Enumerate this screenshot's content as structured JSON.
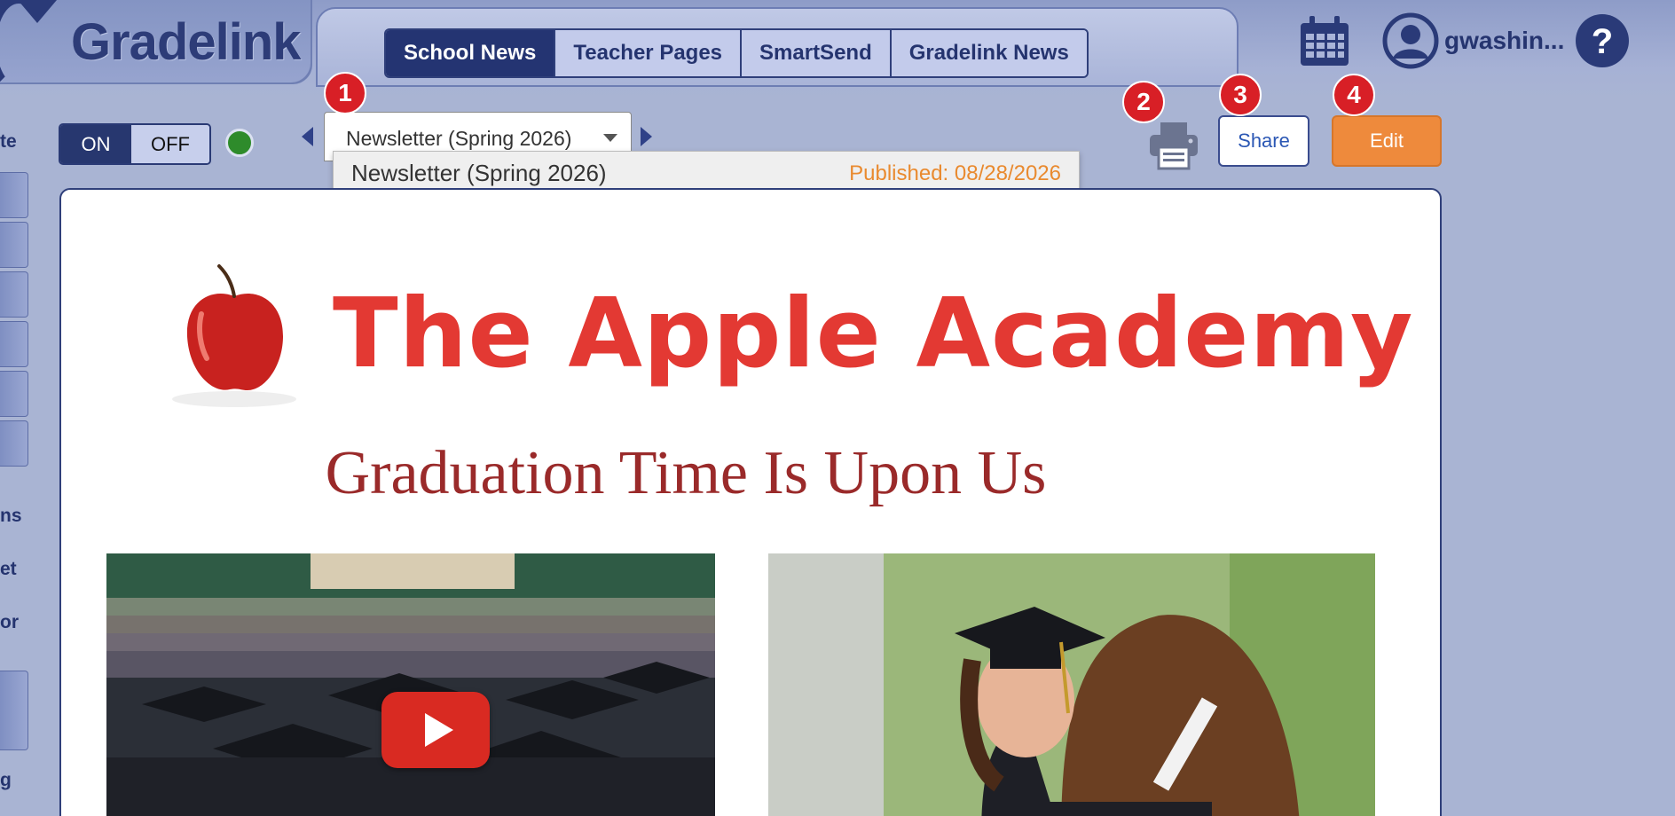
{
  "app": {
    "name": "Gradelink"
  },
  "nav": {
    "tabs": [
      {
        "label": "School News",
        "active": true
      },
      {
        "label": "Teacher Pages",
        "active": false
      },
      {
        "label": "SmartSend",
        "active": false
      },
      {
        "label": "Gradelink News",
        "active": false
      }
    ]
  },
  "user": {
    "name": "gwashin..."
  },
  "icons": {
    "calendar": "calendar-icon",
    "user": "user-avatar-icon",
    "help": "help-icon",
    "printer": "printer-icon"
  },
  "sidebar": {
    "labels": [
      "te",
      "ns",
      "et",
      "or",
      "g"
    ]
  },
  "toolbar": {
    "toggle_on": "ON",
    "toggle_off": "OFF",
    "status_color": "#2e8b2b",
    "newsletter_select": "Newsletter (Spring 2026)",
    "share_label": "Share",
    "edit_label": "Edit"
  },
  "dropdown": {
    "option_title": "Newsletter (Spring 2026)",
    "option_status": "Published: 08/28/2026"
  },
  "badges": [
    "1",
    "2",
    "3",
    "4"
  ],
  "newsletter": {
    "banner_title": "The Apple Academy",
    "headline": "Graduation Time Is Upon Us"
  },
  "colors": {
    "brand_navy": "#243472",
    "accent_orange": "#ee8a3c",
    "banner_red": "#e33933",
    "headline_red": "#9a2a2a",
    "badge_red": "#d81f26"
  }
}
